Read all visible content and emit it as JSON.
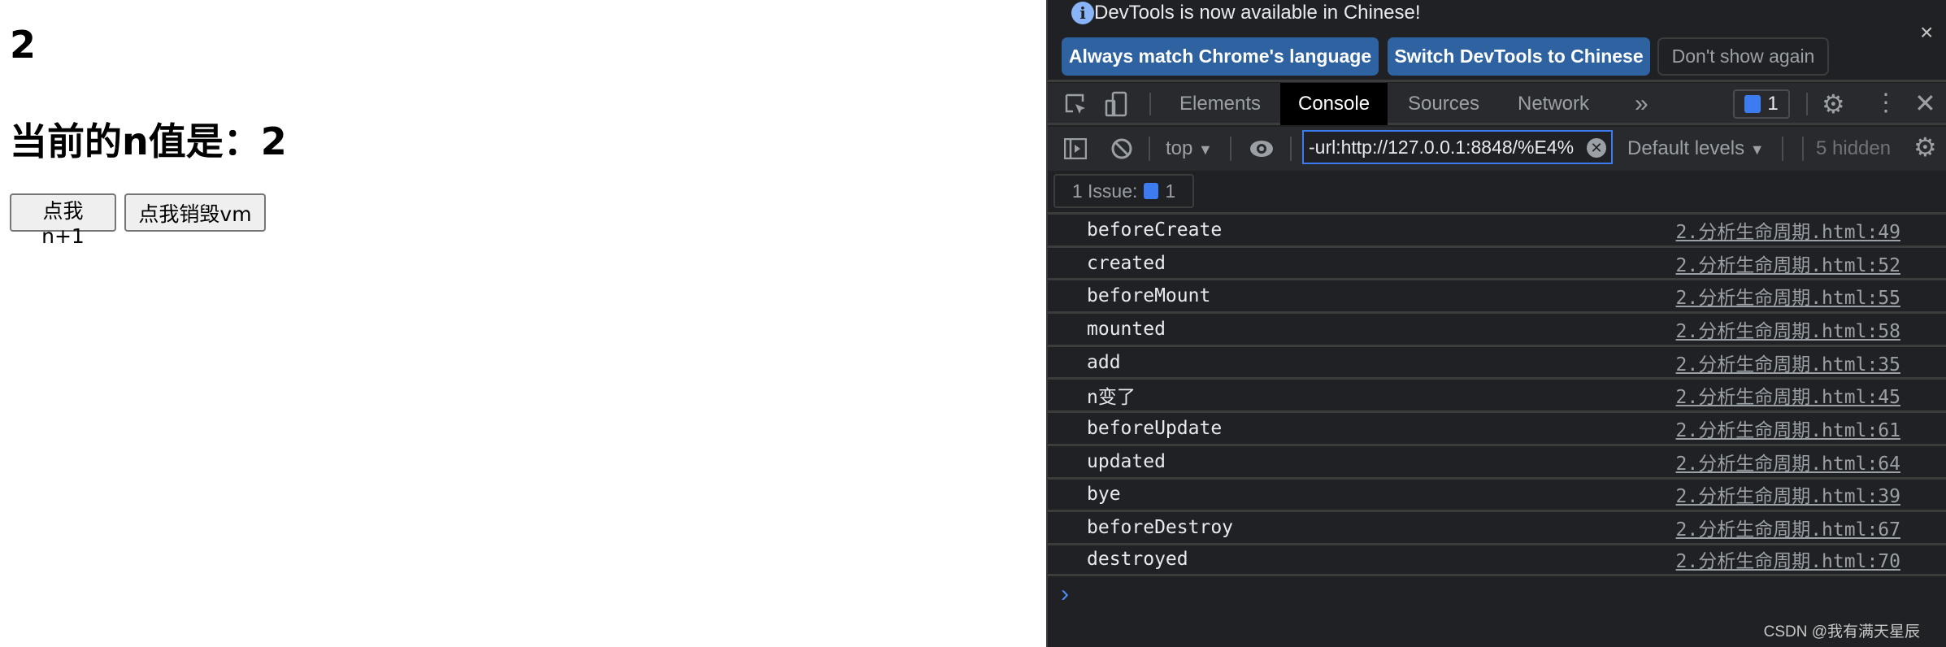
{
  "page": {
    "count": "2",
    "heading": "当前的n值是：2",
    "buttons": [
      "点我n+1",
      "点我销毁vm"
    ]
  },
  "devtools": {
    "infobar": {
      "message": "DevTools is now available in Chinese!",
      "buttons": [
        "Always match Chrome's language",
        "Switch DevTools to Chinese",
        "Don't show again"
      ],
      "close": "×"
    },
    "tabs": [
      "Elements",
      "Console",
      "Sources",
      "Network"
    ],
    "more_tabs": "»",
    "active_tab": "Console",
    "issues_badge": "1",
    "toolbar": {
      "context": "top",
      "filter_value": "-url:http://127.0.0.1:8848/%E4%",
      "levels": "Default levels",
      "hidden": "5 hidden"
    },
    "issues": {
      "label": "1 Issue:",
      "count": "1"
    },
    "logs": [
      {
        "message": "beforeCreate",
        "source": "2.分析生命周期.html:49"
      },
      {
        "message": "created",
        "source": "2.分析生命周期.html:52"
      },
      {
        "message": "beforeMount",
        "source": "2.分析生命周期.html:55"
      },
      {
        "message": "mounted",
        "source": "2.分析生命周期.html:58"
      },
      {
        "message": "add",
        "source": "2.分析生命周期.html:35"
      },
      {
        "message": "n变了",
        "source": "2.分析生命周期.html:45"
      },
      {
        "message": "beforeUpdate",
        "source": "2.分析生命周期.html:61"
      },
      {
        "message": "updated",
        "source": "2.分析生命周期.html:64"
      },
      {
        "message": "bye",
        "source": "2.分析生命周期.html:39"
      },
      {
        "message": "beforeDestroy",
        "source": "2.分析生命周期.html:67"
      },
      {
        "message": "destroyed",
        "source": "2.分析生命周期.html:70"
      }
    ],
    "prompt": "›",
    "colors": {
      "accent": "#2e62a0",
      "badge": "#3d7cf0",
      "background": "#202124"
    }
  },
  "watermark": "CSDN @我有满天星辰"
}
